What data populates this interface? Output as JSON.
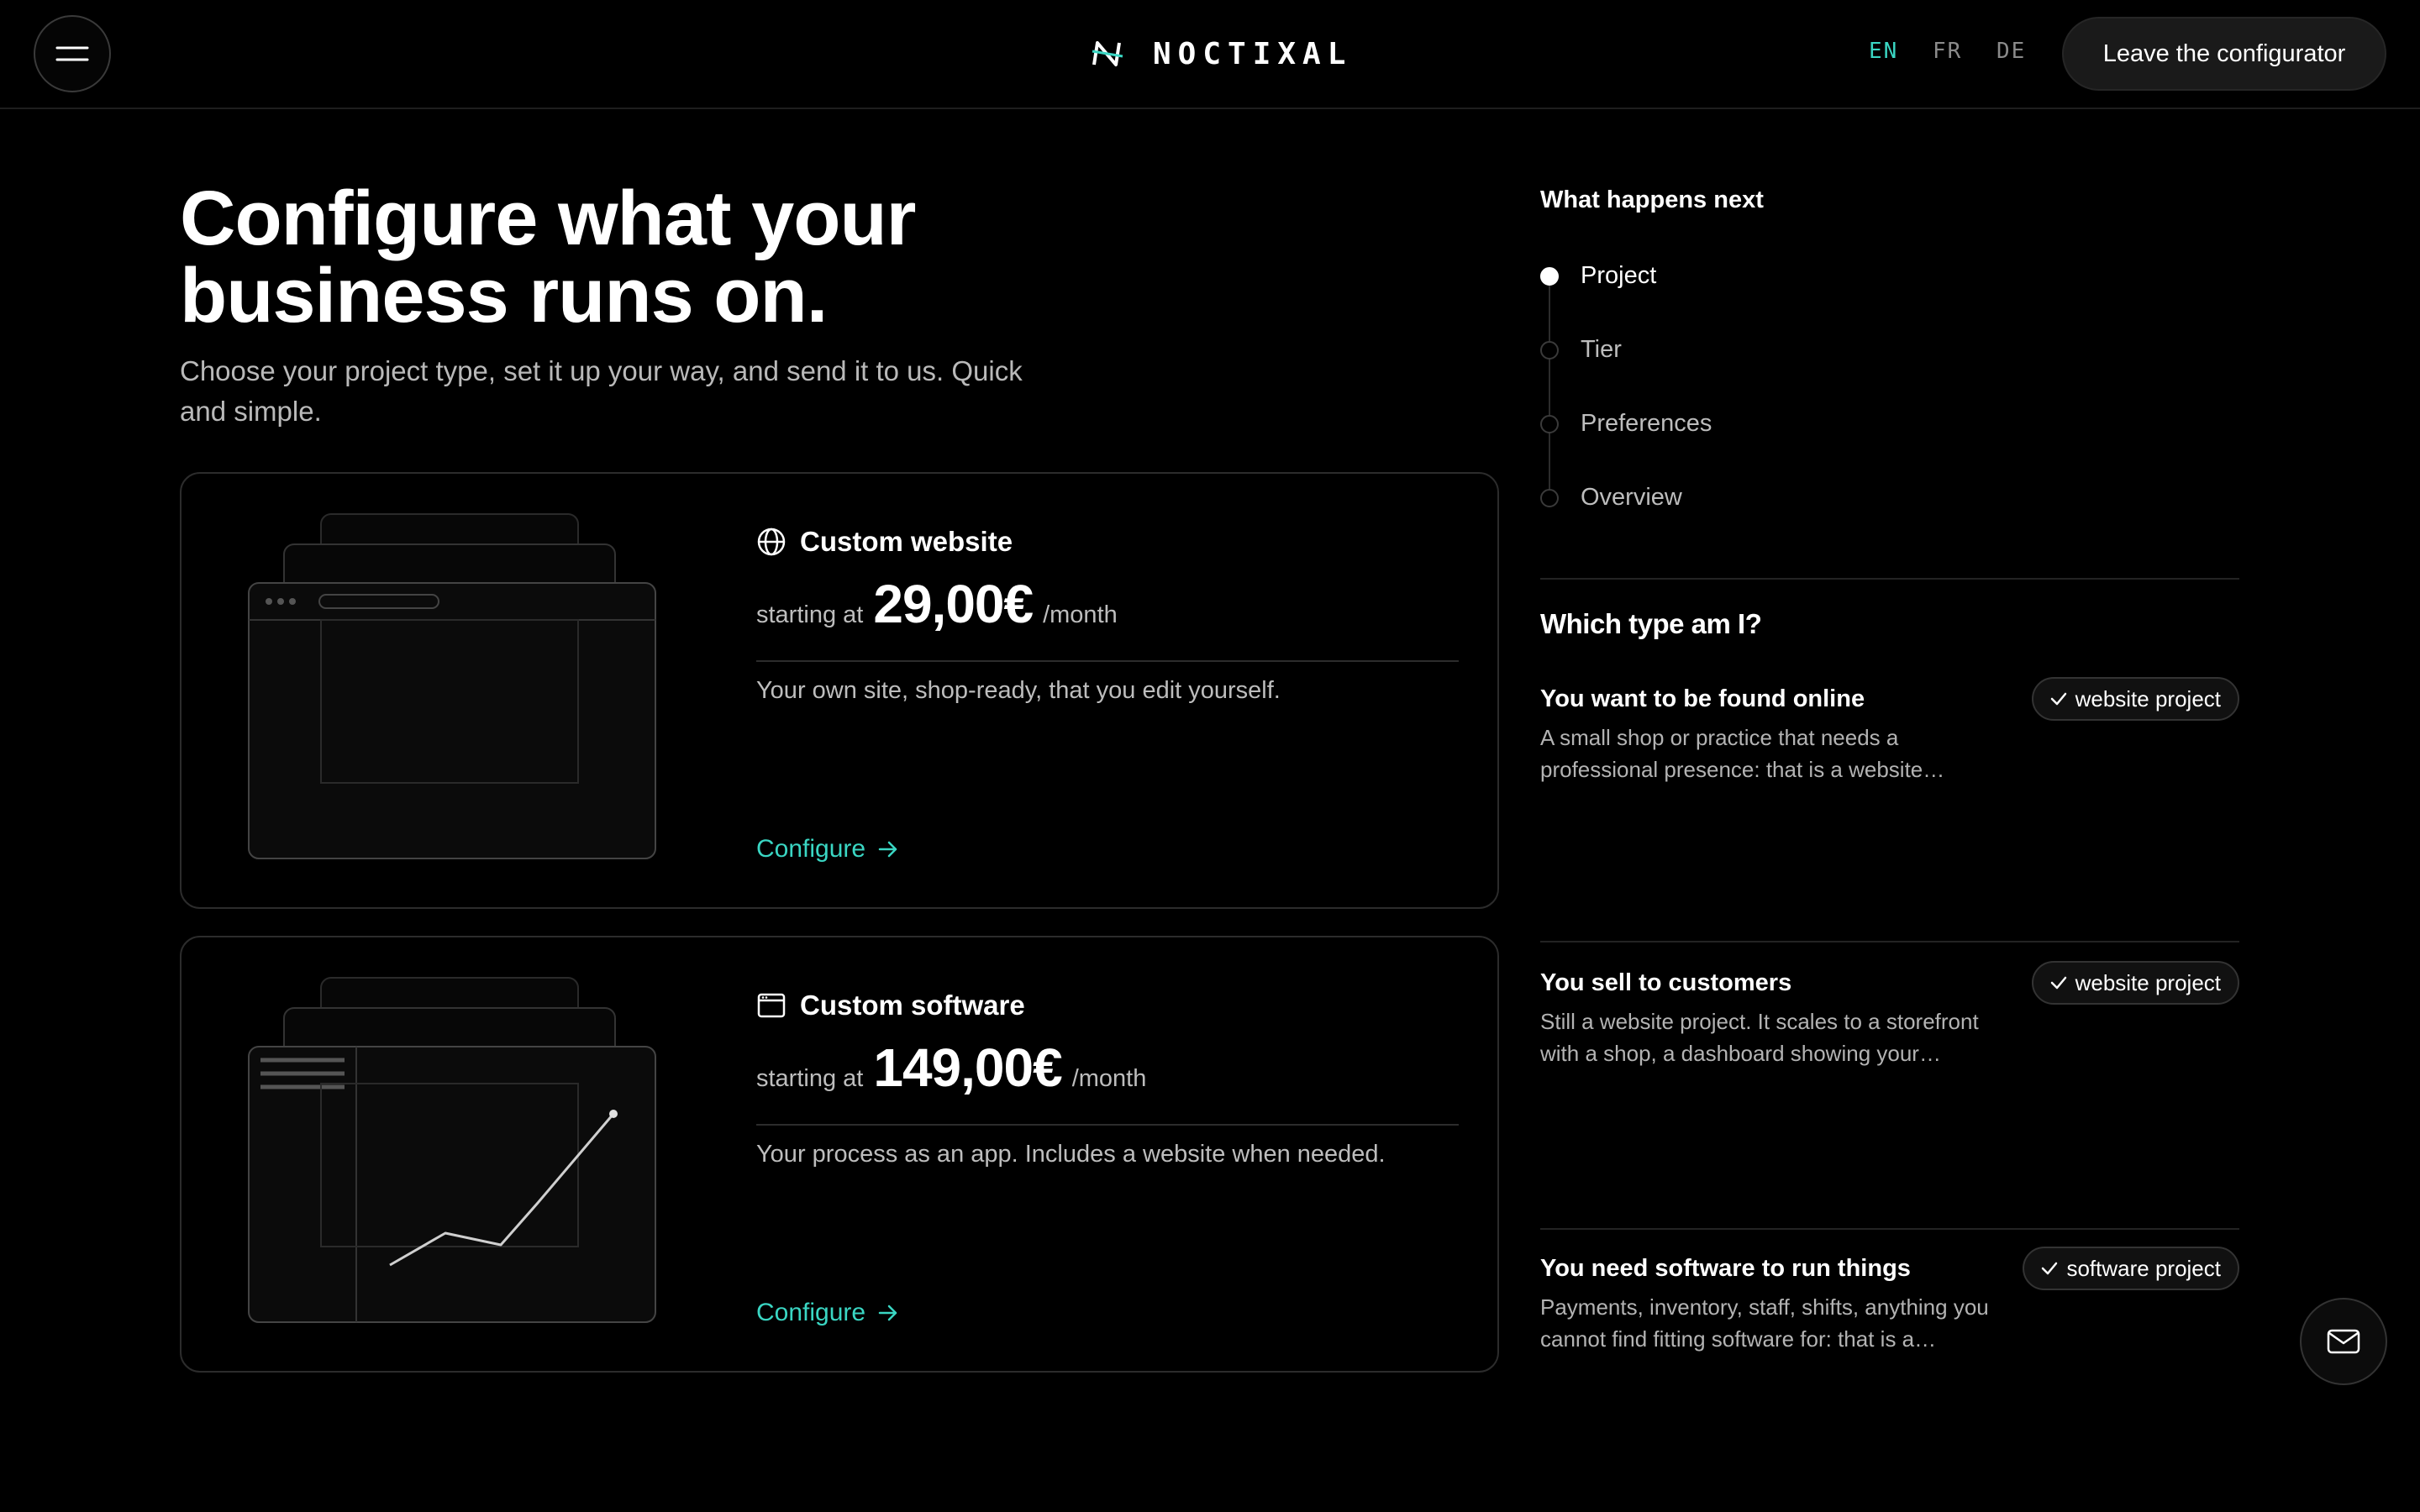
{
  "header": {
    "menu_icon": "hamburger-icon",
    "logo_text": "NOCTIXAL",
    "languages": [
      "EN",
      "FR",
      "DE"
    ],
    "active_language": "EN",
    "leave_label": "Leave the configurator"
  },
  "hero": {
    "title_line1": "Configure what your",
    "title_line2": "business runs on.",
    "subtitle": "Choose your project type, set it up your way, and send it to us. Quick and simple."
  },
  "cards": [
    {
      "icon": "globe-icon",
      "title": "Custom website",
      "price_prefix": "starting at",
      "price": "29,00€",
      "price_suffix": "/month",
      "description": "Your own site, shop-ready, that you edit yourself.",
      "cta": "Configure"
    },
    {
      "icon": "app-window-icon",
      "title": "Custom software",
      "price_prefix": "starting at",
      "price": "149,00€",
      "price_suffix": "/month",
      "description": "Your process as an app. Includes a website when needed.",
      "cta": "Configure"
    }
  ],
  "next": {
    "title": "What happens next",
    "steps": [
      "Project",
      "Tier",
      "Preferences",
      "Overview"
    ],
    "active_step": "Project"
  },
  "which": {
    "title": "Which type am I?",
    "items": [
      {
        "title": "You want to be found online",
        "text": "A small shop or practice that needs a professional presence: that is a website…",
        "badge": "website project"
      },
      {
        "title": "You sell to customers",
        "text": "Still a website project. It scales to a storefront with a shop, a dashboard showing your…",
        "badge": "website project"
      },
      {
        "title": "You need software to run things",
        "text": "Payments, inventory, staff, shifts, anything you cannot find fitting software for: that is a…",
        "badge": "software project"
      }
    ]
  },
  "colors": {
    "accent": "#3ad6c3",
    "background": "#000000",
    "border": "#2c2c2c"
  }
}
